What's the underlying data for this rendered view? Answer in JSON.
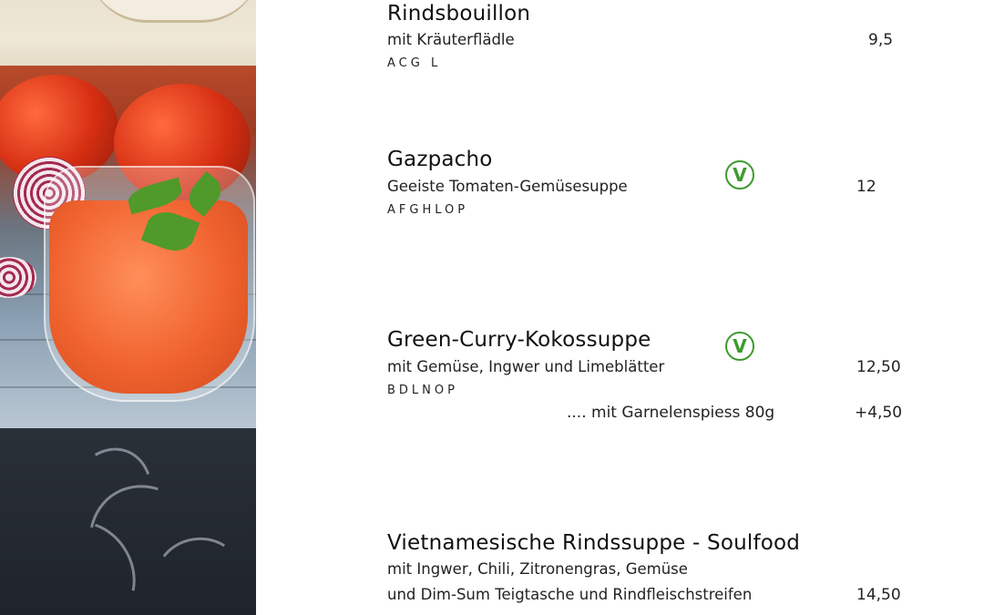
{
  "menu": {
    "items": [
      {
        "title": "Rindsbouillon",
        "description": [
          "mit Kräuterflädle"
        ],
        "allergens": "ACG L",
        "price": "9,5",
        "vegetarian": false
      },
      {
        "title": "Gazpacho",
        "description": [
          "Geeiste Tomaten-Gemüsesuppe"
        ],
        "allergens": "AFGHLOP",
        "price": "12",
        "vegetarian": true,
        "badge": "V"
      },
      {
        "title": "Green-Curry-Kokossuppe",
        "description": [
          "mit Gemüse, Ingwer und Limeblätter"
        ],
        "allergens": "BDLNOP",
        "price": "12,50",
        "vegetarian": true,
        "badge": "V",
        "addon": {
          "label": ".... mit Garnelenspiess 80g",
          "price": "+4,50"
        }
      },
      {
        "title": "Vietnamesische Rindssuppe - Soulfood",
        "description": [
          "mit Ingwer, Chili, Zitronengras, Gemüse",
          "und Dim-Sum Teigtasche und Rindfleischstreifen"
        ],
        "price": "14,50",
        "vegetarian": false
      }
    ]
  },
  "colors": {
    "veg_badge": "#3e9b2e",
    "text": "#111111"
  }
}
